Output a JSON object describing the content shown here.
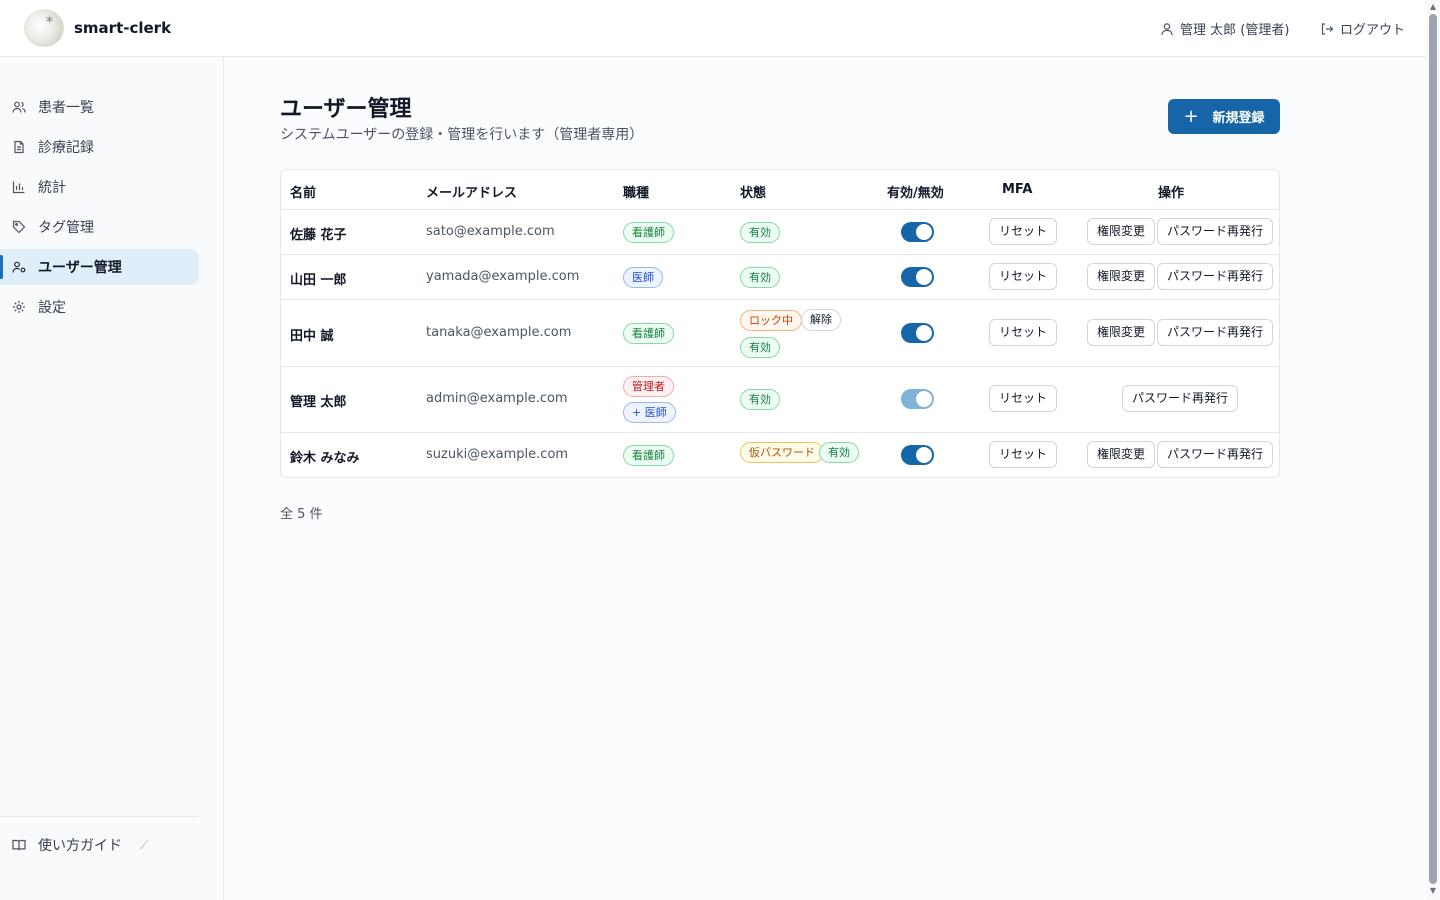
{
  "app": {
    "title": "smart-clerk"
  },
  "header": {
    "user": "管理 太郎 (管理者)",
    "logout": "ログアウト"
  },
  "sidebar": {
    "items": [
      {
        "label": "患者一覧",
        "icon": "users-icon"
      },
      {
        "label": "診療記録",
        "icon": "document-icon"
      },
      {
        "label": "統計",
        "icon": "bar-chart-icon"
      },
      {
        "label": "タグ管理",
        "icon": "tag-icon"
      },
      {
        "label": "ユーザー管理",
        "icon": "user-cog-icon",
        "active": true
      },
      {
        "label": "設定",
        "icon": "gear-icon"
      }
    ],
    "guide": {
      "label": "使い方ガイド",
      "ext": "⟋"
    }
  },
  "page": {
    "title": "ユーザー管理",
    "subtitle": "システムユーザーの登録・管理を行います（管理者専用）",
    "new_button": {
      "plus": "+",
      "label": "新規登録"
    }
  },
  "table": {
    "headers": [
      "名前",
      "メールアドレス",
      "職種",
      "状態",
      "有効/無効",
      "MFA",
      "操作"
    ],
    "rows": [
      {
        "name": "佐藤 花子",
        "email": "sato@example.com",
        "roles": [
          "看護師"
        ],
        "status": [
          "有効"
        ],
        "enabled": true,
        "mfa": "リセット",
        "actions": [
          "権限変更",
          "パスワード再発行"
        ]
      },
      {
        "name": "山田 一郎",
        "email": "yamada@example.com",
        "roles": [
          "医師"
        ],
        "status": [
          "有効"
        ],
        "enabled": true,
        "mfa": "リセット",
        "actions": [
          "権限変更",
          "パスワード再発行"
        ]
      },
      {
        "name": "田中 誠",
        "email": "tanaka@example.com",
        "roles": [
          "看護師"
        ],
        "status": [
          "ロック中",
          "解除",
          "有効"
        ],
        "enabled": true,
        "mfa": "リセット",
        "actions": [
          "権限変更",
          "パスワード再発行"
        ]
      },
      {
        "name": "管理 太郎",
        "email": "admin@example.com",
        "roles": [
          "管理者",
          "+ 医師"
        ],
        "status": [
          "有効"
        ],
        "enabled": true,
        "toggle_disabled": true,
        "mfa": "リセット",
        "actions": [
          "パスワード再発行"
        ]
      },
      {
        "name": "鈴木 みなみ",
        "email": "suzuki@example.com",
        "roles": [
          "看護師"
        ],
        "status": [
          "仮パスワード",
          "有効"
        ],
        "enabled": true,
        "mfa": "リセット",
        "actions": [
          "権限変更",
          "パスワード再発行"
        ]
      }
    ]
  },
  "footer": {
    "count": "全 5 件"
  },
  "colors": {
    "primary": "#1565a8",
    "active_nav_bg": "#e0eefa",
    "green": "#15803d",
    "blue": "#1d4ed8",
    "red": "#b91c1c",
    "orange": "#c2410c"
  }
}
